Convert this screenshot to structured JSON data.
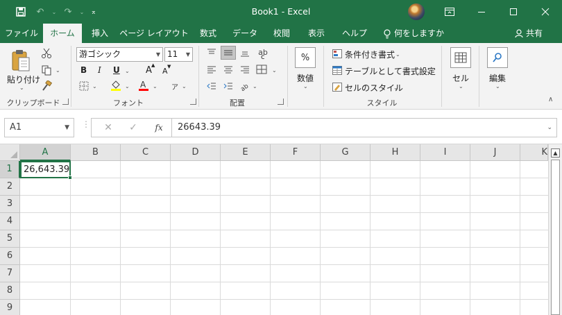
{
  "title_bar": {
    "title": "Book1  -  Excel",
    "qat": {
      "save_icon": "save-icon",
      "undo_icon": "undo-icon",
      "redo_icon": "redo-icon"
    }
  },
  "tabs": [
    {
      "label": "ファイル",
      "active": false
    },
    {
      "label": "ホーム",
      "active": true
    },
    {
      "label": "挿入",
      "active": false
    },
    {
      "label": "ページ レイアウト",
      "active": false
    },
    {
      "label": "数式",
      "active": false
    },
    {
      "label": "データ",
      "active": false
    },
    {
      "label": "校閲",
      "active": false
    },
    {
      "label": "表示",
      "active": false
    },
    {
      "label": "ヘルプ",
      "active": false
    }
  ],
  "tell_me": "何をしますか",
  "share": "共有",
  "ribbon": {
    "clipboard": {
      "paste_label": "貼り付け",
      "group_label": "クリップボード"
    },
    "font": {
      "font_name": "游ゴシック",
      "font_size": "11",
      "bold": "B",
      "italic": "I",
      "underline": "U",
      "grow": "A",
      "shrink": "A",
      "group_label": "フォント",
      "fill_color": "#ffff00",
      "font_color": "#ff0000"
    },
    "alignment": {
      "group_label": "配置",
      "wrap_glyph": "ab",
      "wrap_sub": "c"
    },
    "number": {
      "button_label": "数値",
      "glyph": "%"
    },
    "styles": {
      "conditional": "条件付き書式",
      "as_table": "テーブルとして書式設定",
      "cell_styles": "セルのスタイル",
      "group_label": "スタイル"
    },
    "cells": {
      "button_label": "セル"
    },
    "editing": {
      "button_label": "編集"
    }
  },
  "formula_bar": {
    "name_box": "A1",
    "fx": "fx",
    "value": "26643.39"
  },
  "sheet": {
    "columns": [
      "A",
      "B",
      "C",
      "D",
      "E",
      "F",
      "G",
      "H",
      "I",
      "J",
      "K"
    ],
    "rows": [
      "1",
      "2",
      "3",
      "4",
      "5",
      "6",
      "7",
      "8",
      "9"
    ],
    "selected_cell": "A1",
    "a1_display": "26,643.39"
  },
  "colors": {
    "accent": "#217346"
  }
}
